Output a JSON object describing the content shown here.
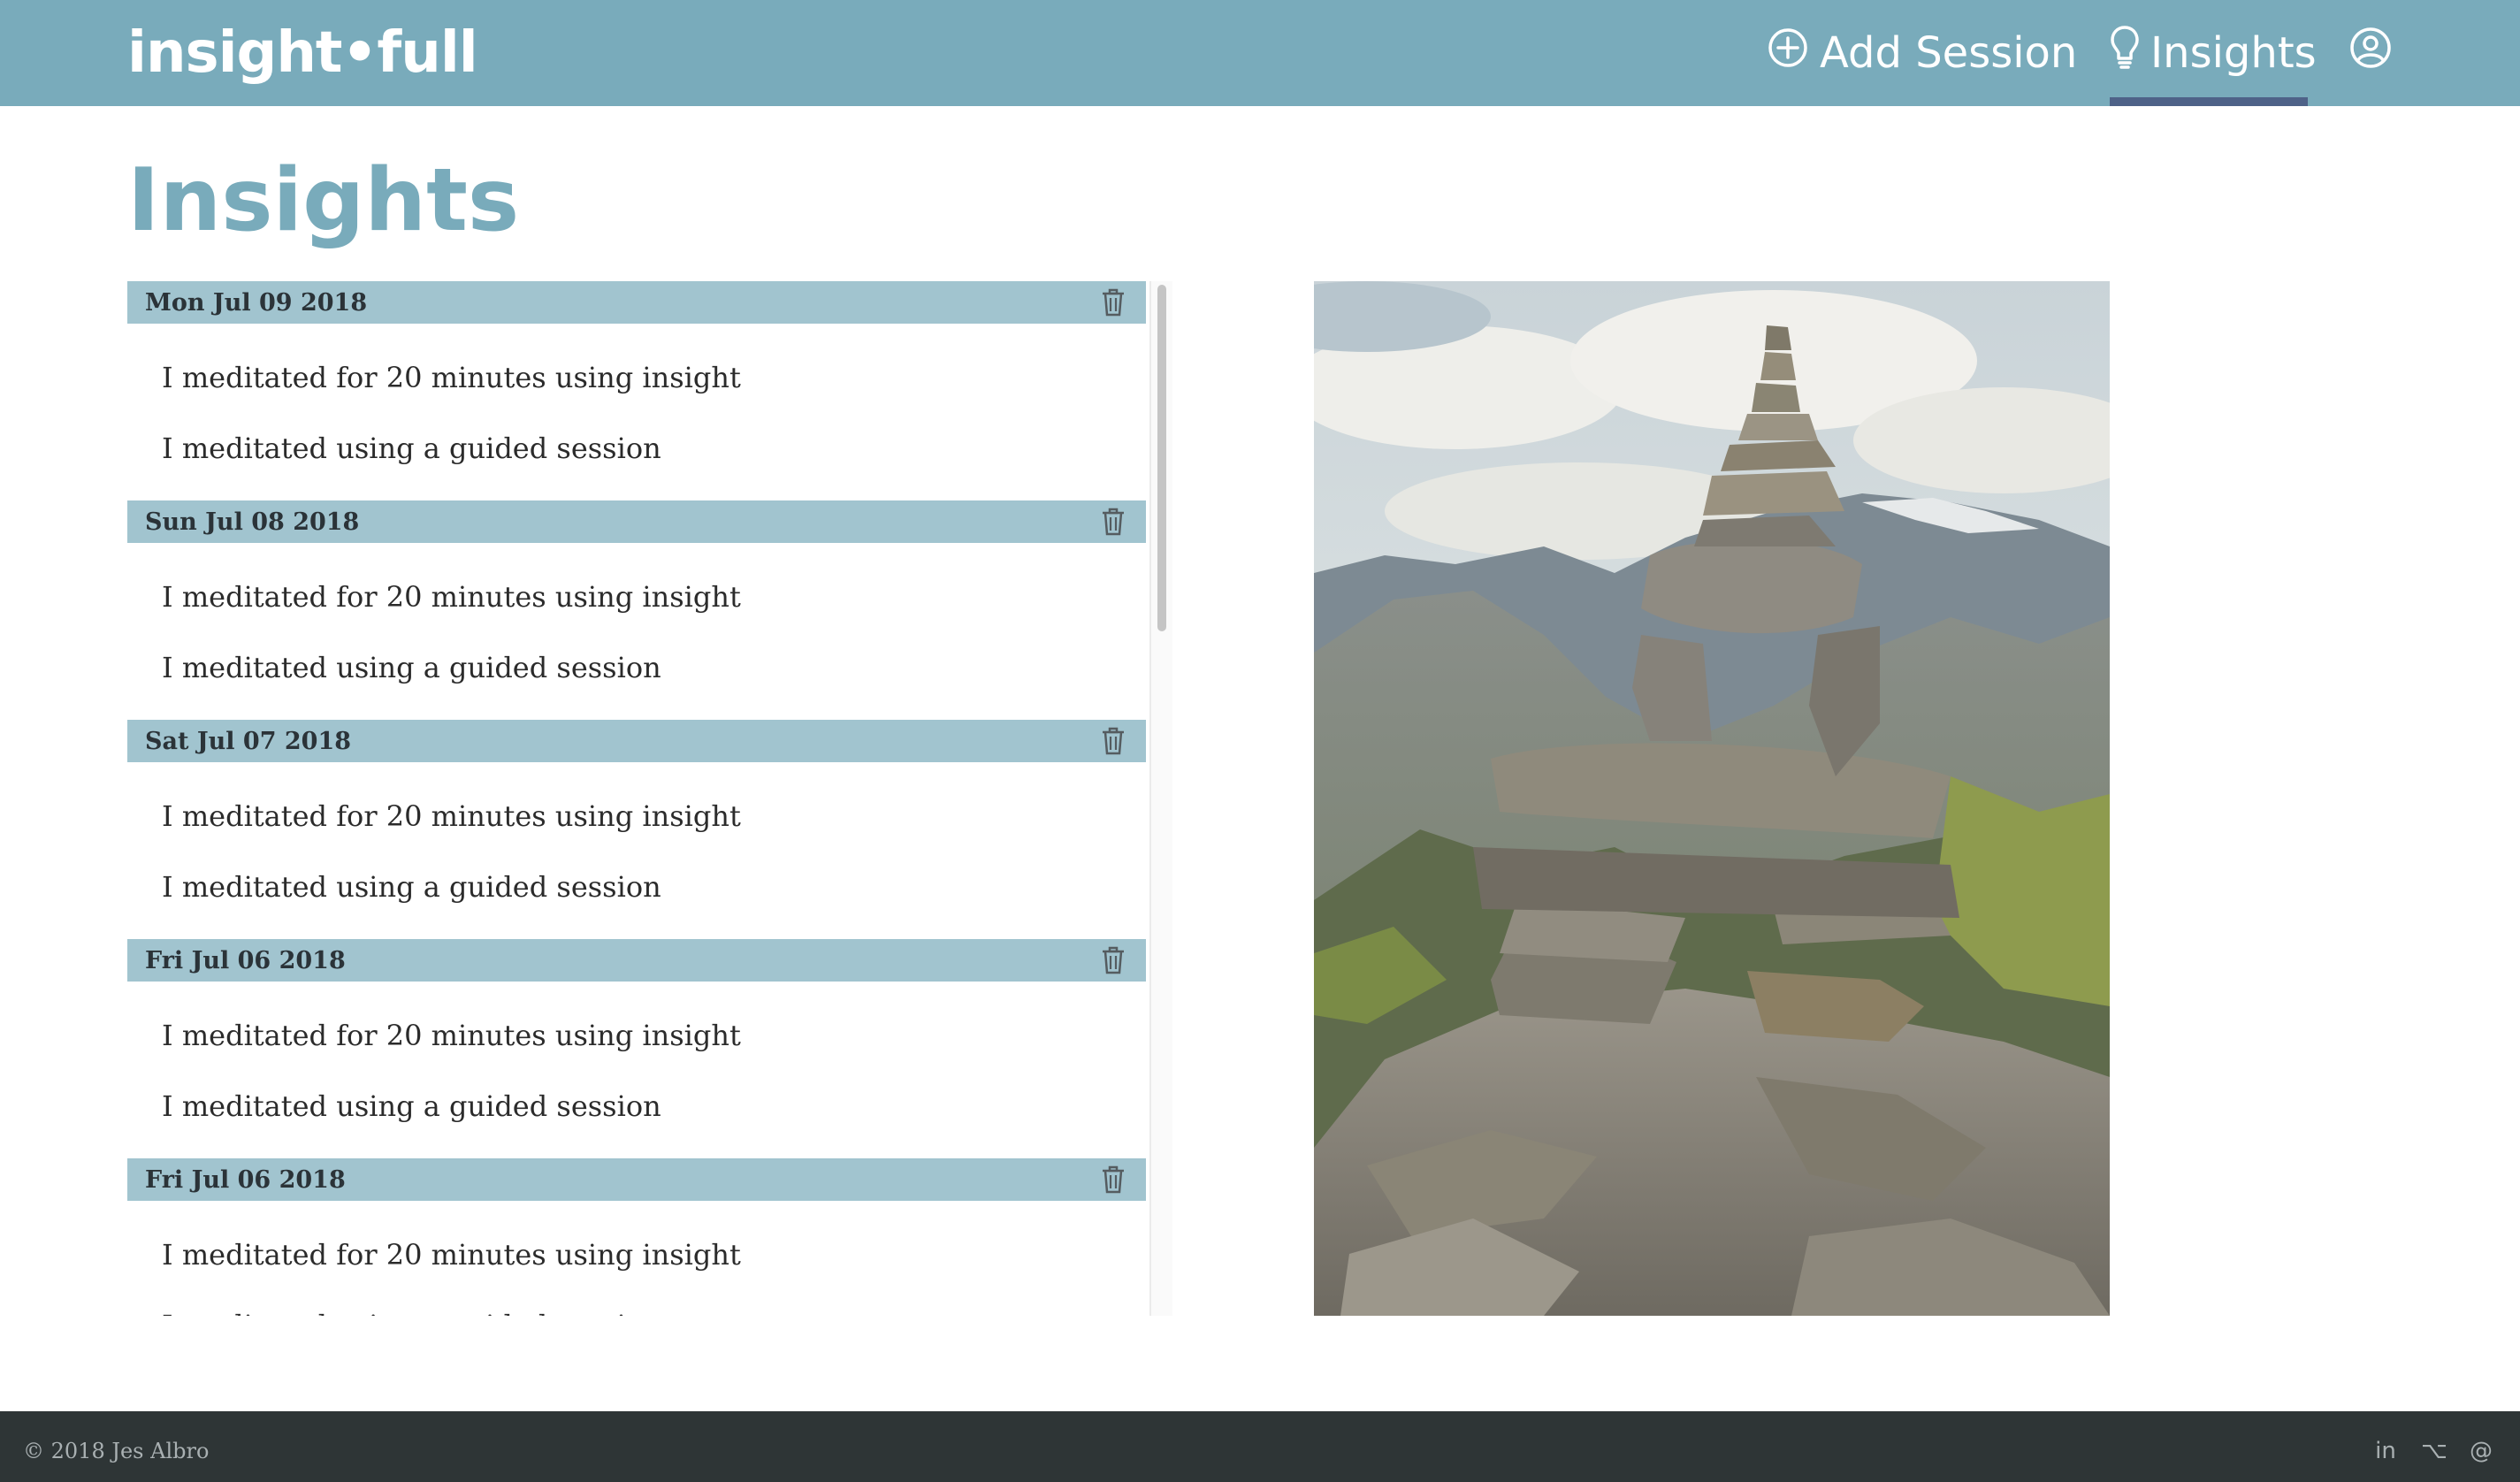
{
  "header": {
    "brand": "insight•full",
    "nav": {
      "add_session": "Add Session",
      "insights": "Insights"
    },
    "icons": {
      "add": "plus-circle-icon",
      "insights": "lightbulb-icon",
      "account": "user-circle-icon"
    }
  },
  "page": {
    "title": "Insights"
  },
  "days": [
    {
      "date": "Mon Jul 09 2018",
      "entries": [
        "I meditated for 20 minutes using insight",
        "I meditated using a guided session"
      ]
    },
    {
      "date": "Sun Jul 08 2018",
      "entries": [
        "I meditated for 20 minutes using insight",
        "I meditated using a guided session"
      ]
    },
    {
      "date": "Sat Jul 07 2018",
      "entries": [
        "I meditated for 20 minutes using insight",
        "I meditated using a guided session"
      ]
    },
    {
      "date": "Fri Jul 06 2018",
      "entries": [
        "I meditated for 20 minutes using insight",
        "I meditated using a guided session"
      ]
    },
    {
      "date": "Fri Jul 06 2018",
      "entries": [
        "I meditated for 20 minutes using insight",
        "I meditated using a guided session"
      ]
    }
  ],
  "footer": {
    "copyright": "© 2018 Jes Albro",
    "links": [
      {
        "label": "in",
        "icon": "linkedin-icon"
      },
      {
        "label": "⌥",
        "icon": "github-icon"
      },
      {
        "label": "@",
        "icon": "email-icon"
      }
    ]
  },
  "colors": {
    "header_bg": "#79abbb",
    "day_header_bg": "#a1c4cf",
    "active_underline": "#4e6288",
    "title": "#79abbb",
    "footer_bg": "#2e3536"
  }
}
